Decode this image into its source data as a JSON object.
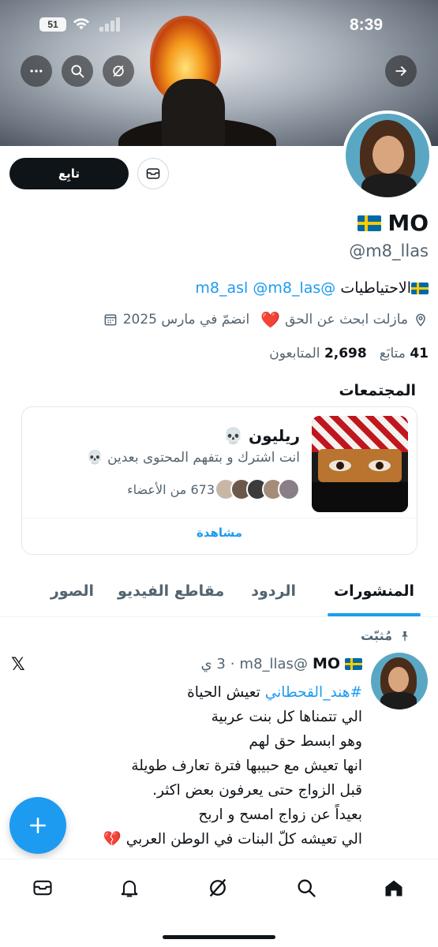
{
  "status_bar": {
    "time": "8:39",
    "battery": "51"
  },
  "profile": {
    "name": "MO",
    "handle": "@m8_llas",
    "bio_text": "الاحتياطيات",
    "bio_links": [
      "@m8_asl",
      "@m8_las"
    ],
    "location": "مازلت ابحث عن الحق",
    "heart": "❤️",
    "joined": "انضمّ في مارس 2025",
    "following_count": "41",
    "following_label": "متابَع",
    "followers_count": "2,698",
    "followers_label": "المتابعون",
    "follow_label": "تابِع"
  },
  "communities": {
    "title": "المجتمعات",
    "name": "ريليون 💀",
    "description": "انت اشترك و بتفهم المحتوى بعدين 💀",
    "members": "673 من الأعضاء",
    "view_label": "مشاهدة"
  },
  "tabs": [
    "المنشورات",
    "الردود",
    "مقاطع الفيديو",
    "الصور"
  ],
  "pinned_label": "مُثبّت",
  "tweet": {
    "name": "MO",
    "handle": "@m8_llas",
    "separator": "·",
    "time": "3 ي",
    "hashtag": "#هند_القحطاني",
    "line1_rest": "تعيش الحياة",
    "lines": [
      "الي تتمناها كل بنت عربية",
      "وهو ابسط حق لهم",
      "انها تعيش مع حبيبها فترة تعارف طويلة",
      "قبل الزواج حتى يعرفون بعض اكثر.",
      "بعيداً عن زواج امسح و اربح",
      "الي تعيشه كلّ البنات في الوطن العربي 💔"
    ]
  },
  "x_logo": "𝕏",
  "colors": {
    "accent": "#1d9bf0",
    "text": "#0f1419",
    "muted": "#536471"
  },
  "icons": [
    "more-icon",
    "search-icon",
    "grok-icon",
    "forward-arrow-icon",
    "mail-icon",
    "location-icon",
    "calendar-icon",
    "pin-icon",
    "plus-icon",
    "home-icon",
    "bell-icon"
  ]
}
